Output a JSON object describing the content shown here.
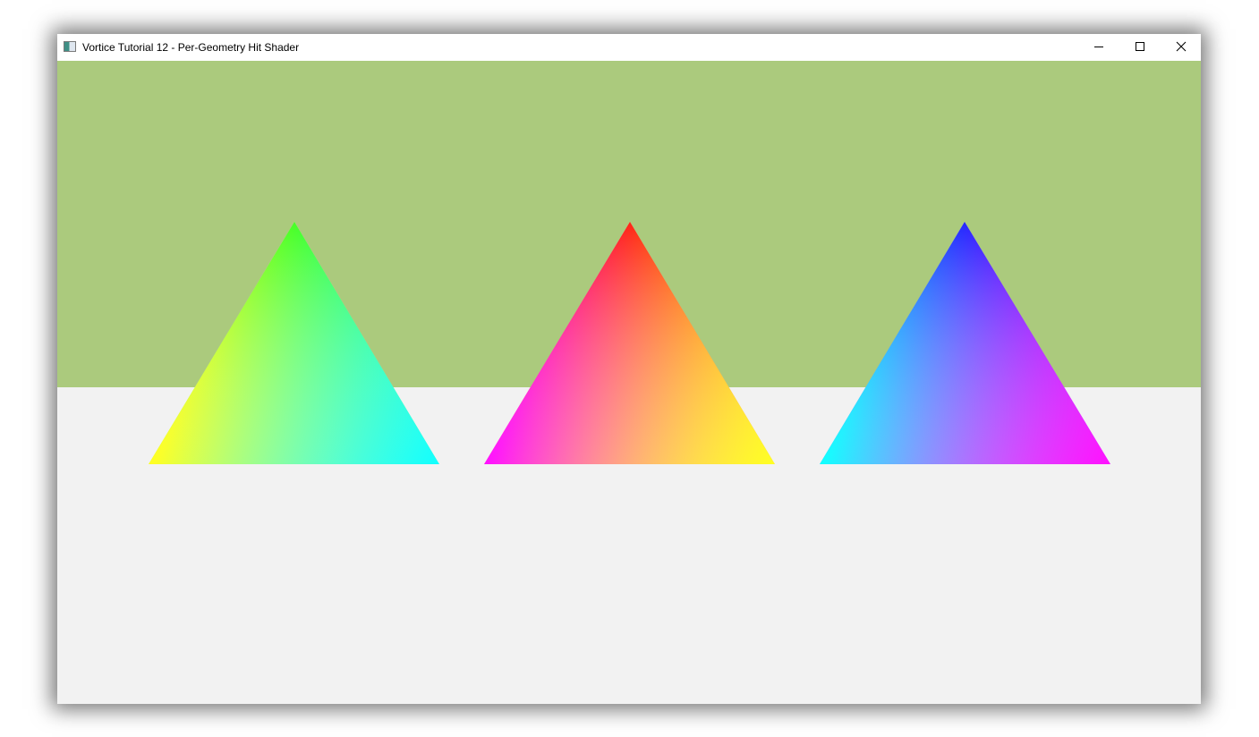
{
  "window": {
    "title": "Vortice Tutorial 12 - Per-Geometry Hit Shader",
    "icon": "application-window-icon",
    "controls": {
      "minimize_icon": "minimize-icon",
      "maximize_icon": "maximize-icon",
      "close_icon": "close-icon"
    }
  },
  "scene": {
    "background_color": "#abca7d",
    "floor_color": "#f2f2f2",
    "triangles": [
      {
        "name": "left",
        "top_color": "#44ff22",
        "left_color": "#ffff22",
        "right_color": "#11ffff",
        "center_color": "#c6fd9f"
      },
      {
        "name": "middle",
        "top_color": "#ff2211",
        "left_color": "#ff11ff",
        "right_color": "#ffff22",
        "center_color": "#ffa5a5"
      },
      {
        "name": "right",
        "top_color": "#2222ff",
        "left_color": "#11ffff",
        "right_color": "#ff11ff",
        "center_color": "#a8a7ff"
      }
    ]
  }
}
